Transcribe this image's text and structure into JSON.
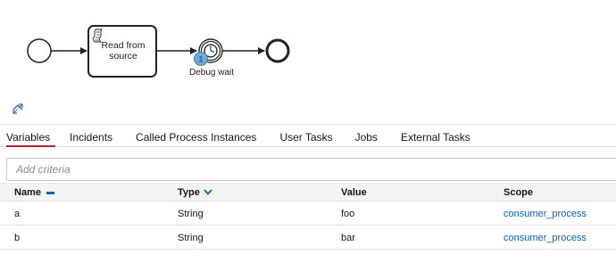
{
  "diagram": {
    "task_label": "Read from source",
    "event_label": "Debug wait",
    "instance_badge": "1",
    "task_icon": "script-icon",
    "event_icon": "timer-icon",
    "controls": [
      "collapse-up-icon",
      "expand-icon"
    ]
  },
  "tabs": [
    {
      "label": "Variables",
      "active": true
    },
    {
      "label": "Incidents"
    },
    {
      "label": "Called Process Instances"
    },
    {
      "label": "User Tasks"
    },
    {
      "label": "Jobs"
    },
    {
      "label": "External Tasks"
    }
  ],
  "filter": {
    "placeholder": "Add criteria"
  },
  "table": {
    "columns": {
      "name": "Name",
      "type": "Type",
      "value": "Value",
      "scope": "Scope"
    },
    "rows": [
      {
        "name": "a",
        "type": "String",
        "value": "foo",
        "scope": "consumer_process"
      },
      {
        "name": "b",
        "type": "String",
        "value": "bar",
        "scope": "consumer_process"
      }
    ]
  },
  "colors": {
    "accent_tab": "#b22234",
    "link": "#0f62b4",
    "badge": "#6fa8dc",
    "sort_icon": "#0f62b4"
  }
}
